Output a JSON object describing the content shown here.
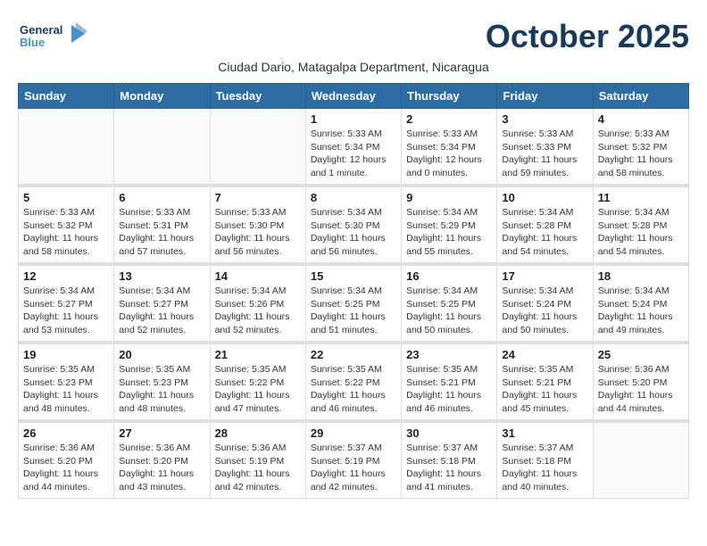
{
  "header": {
    "logo_general": "General",
    "logo_blue": "Blue",
    "month": "October 2025",
    "location": "Ciudad Dario, Matagalpa Department, Nicaragua"
  },
  "weekdays": [
    "Sunday",
    "Monday",
    "Tuesday",
    "Wednesday",
    "Thursday",
    "Friday",
    "Saturday"
  ],
  "weeks": [
    [
      {
        "day": "",
        "info": ""
      },
      {
        "day": "",
        "info": ""
      },
      {
        "day": "",
        "info": ""
      },
      {
        "day": "1",
        "info": "Sunrise: 5:33 AM\nSunset: 5:34 PM\nDaylight: 12 hours\nand 1 minute."
      },
      {
        "day": "2",
        "info": "Sunrise: 5:33 AM\nSunset: 5:34 PM\nDaylight: 12 hours\nand 0 minutes."
      },
      {
        "day": "3",
        "info": "Sunrise: 5:33 AM\nSunset: 5:33 PM\nDaylight: 11 hours\nand 59 minutes."
      },
      {
        "day": "4",
        "info": "Sunrise: 5:33 AM\nSunset: 5:32 PM\nDaylight: 11 hours\nand 58 minutes."
      }
    ],
    [
      {
        "day": "5",
        "info": "Sunrise: 5:33 AM\nSunset: 5:32 PM\nDaylight: 11 hours\nand 58 minutes."
      },
      {
        "day": "6",
        "info": "Sunrise: 5:33 AM\nSunset: 5:31 PM\nDaylight: 11 hours\nand 57 minutes."
      },
      {
        "day": "7",
        "info": "Sunrise: 5:33 AM\nSunset: 5:30 PM\nDaylight: 11 hours\nand 56 minutes."
      },
      {
        "day": "8",
        "info": "Sunrise: 5:34 AM\nSunset: 5:30 PM\nDaylight: 11 hours\nand 56 minutes."
      },
      {
        "day": "9",
        "info": "Sunrise: 5:34 AM\nSunset: 5:29 PM\nDaylight: 11 hours\nand 55 minutes."
      },
      {
        "day": "10",
        "info": "Sunrise: 5:34 AM\nSunset: 5:28 PM\nDaylight: 11 hours\nand 54 minutes."
      },
      {
        "day": "11",
        "info": "Sunrise: 5:34 AM\nSunset: 5:28 PM\nDaylight: 11 hours\nand 54 minutes."
      }
    ],
    [
      {
        "day": "12",
        "info": "Sunrise: 5:34 AM\nSunset: 5:27 PM\nDaylight: 11 hours\nand 53 minutes."
      },
      {
        "day": "13",
        "info": "Sunrise: 5:34 AM\nSunset: 5:27 PM\nDaylight: 11 hours\nand 52 minutes."
      },
      {
        "day": "14",
        "info": "Sunrise: 5:34 AM\nSunset: 5:26 PM\nDaylight: 11 hours\nand 52 minutes."
      },
      {
        "day": "15",
        "info": "Sunrise: 5:34 AM\nSunset: 5:25 PM\nDaylight: 11 hours\nand 51 minutes."
      },
      {
        "day": "16",
        "info": "Sunrise: 5:34 AM\nSunset: 5:25 PM\nDaylight: 11 hours\nand 50 minutes."
      },
      {
        "day": "17",
        "info": "Sunrise: 5:34 AM\nSunset: 5:24 PM\nDaylight: 11 hours\nand 50 minutes."
      },
      {
        "day": "18",
        "info": "Sunrise: 5:34 AM\nSunset: 5:24 PM\nDaylight: 11 hours\nand 49 minutes."
      }
    ],
    [
      {
        "day": "19",
        "info": "Sunrise: 5:35 AM\nSunset: 5:23 PM\nDaylight: 11 hours\nand 48 minutes."
      },
      {
        "day": "20",
        "info": "Sunrise: 5:35 AM\nSunset: 5:23 PM\nDaylight: 11 hours\nand 48 minutes."
      },
      {
        "day": "21",
        "info": "Sunrise: 5:35 AM\nSunset: 5:22 PM\nDaylight: 11 hours\nand 47 minutes."
      },
      {
        "day": "22",
        "info": "Sunrise: 5:35 AM\nSunset: 5:22 PM\nDaylight: 11 hours\nand 46 minutes."
      },
      {
        "day": "23",
        "info": "Sunrise: 5:35 AM\nSunset: 5:21 PM\nDaylight: 11 hours\nand 46 minutes."
      },
      {
        "day": "24",
        "info": "Sunrise: 5:35 AM\nSunset: 5:21 PM\nDaylight: 11 hours\nand 45 minutes."
      },
      {
        "day": "25",
        "info": "Sunrise: 5:36 AM\nSunset: 5:20 PM\nDaylight: 11 hours\nand 44 minutes."
      }
    ],
    [
      {
        "day": "26",
        "info": "Sunrise: 5:36 AM\nSunset: 5:20 PM\nDaylight: 11 hours\nand 44 minutes."
      },
      {
        "day": "27",
        "info": "Sunrise: 5:36 AM\nSunset: 5:20 PM\nDaylight: 11 hours\nand 43 minutes."
      },
      {
        "day": "28",
        "info": "Sunrise: 5:36 AM\nSunset: 5:19 PM\nDaylight: 11 hours\nand 42 minutes."
      },
      {
        "day": "29",
        "info": "Sunrise: 5:37 AM\nSunset: 5:19 PM\nDaylight: 11 hours\nand 42 minutes."
      },
      {
        "day": "30",
        "info": "Sunrise: 5:37 AM\nSunset: 5:18 PM\nDaylight: 11 hours\nand 41 minutes."
      },
      {
        "day": "31",
        "info": "Sunrise: 5:37 AM\nSunset: 5:18 PM\nDaylight: 11 hours\nand 40 minutes."
      },
      {
        "day": "",
        "info": ""
      }
    ]
  ]
}
